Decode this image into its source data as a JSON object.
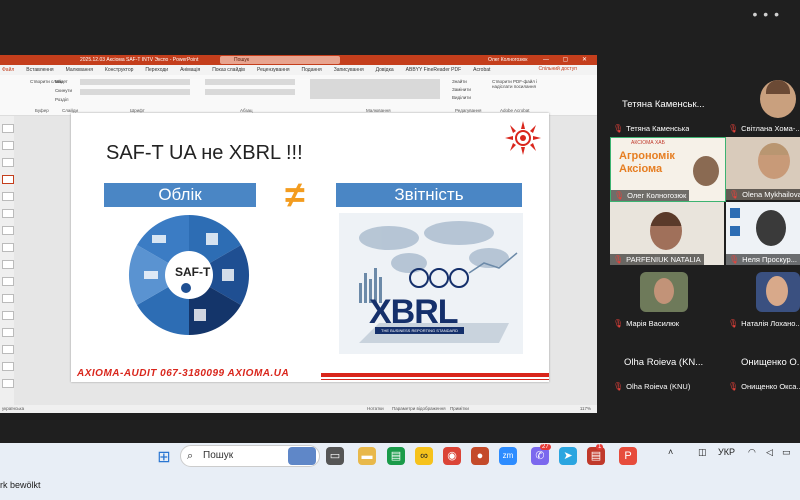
{
  "window": {
    "dots": "• • •"
  },
  "ppt": {
    "doc_title": "2025.12.03 Аксіома SAF-T INTV Экспо - PowerPoint",
    "search_placeholder": "Пошук",
    "user": "Олег Колногозюк",
    "menu": [
      "Файл",
      "Вставлення",
      "Малювання",
      "Конструктор",
      "Переходи",
      "Анімація",
      "Показ слайдів",
      "Рецензування",
      "Подання",
      "Записування",
      "Довідка",
      "ABBYY FineReader PDF",
      "Acrobat"
    ],
    "comments_label": "Спільний доступ",
    "ribbon_groups": [
      "Буфер",
      "Слайди",
      "Шрифт",
      "Абзац",
      "Малювання",
      "Редагування",
      "Adobe Acrobat"
    ],
    "ribbon_sub": [
      "Створити слайд",
      "Макет",
      "Скинути",
      "Розділ"
    ],
    "ribbon_right": [
      "Знайти",
      "Замінити",
      "Виділити",
      "Створити PDF-файл і надіслати посилання"
    ],
    "status_left": "українська",
    "status_notes": "Нотатки",
    "status_display": "Параметри відображення",
    "status_view": "Примітки",
    "zoom": "117%"
  },
  "slide": {
    "title": "SAF-T UA не XBRL !!!",
    "left_box": "Облік",
    "right_box": "Звітність",
    "neq": "≠",
    "center_label": "SAF-T",
    "xbrl_word": "XBRL",
    "xbrl_tagline": "THE BUSINESS REPORTING STANDARD",
    "footer": "AXIOMA-AUDIT 067-3180099 AXIOMA.UA"
  },
  "participants": {
    "name_row1_left": "Тетяна Каменськ...",
    "tiles": [
      {
        "label": "Тетяна Каменська"
      },
      {
        "label": "Світлана Хома-..."
      },
      {
        "label": "Олег Колногозюк"
      },
      {
        "label": "Olena Mykhailova"
      },
      {
        "label": "PARFENIUK NATALIA"
      },
      {
        "label": "Неля Проскур..."
      },
      {
        "label": "Марія Василюк"
      },
      {
        "label": "Наталія Лохано..."
      },
      {
        "label": "Olha Roieva (KNU)"
      },
      {
        "label": "Онищенко Окса..."
      }
    ],
    "name_row5_left": "Olha Roieva (KN...",
    "name_row5_right": "Онищенко О...",
    "tile_logo_text": "Агрономік Аксіома",
    "tile_logo_small": "АКСІОМА ХАБ"
  },
  "taskbar": {
    "weather": "rk bewölkt",
    "search": "Пошук",
    "lang": "УКР",
    "badge1": "27",
    "badge2": "1"
  }
}
